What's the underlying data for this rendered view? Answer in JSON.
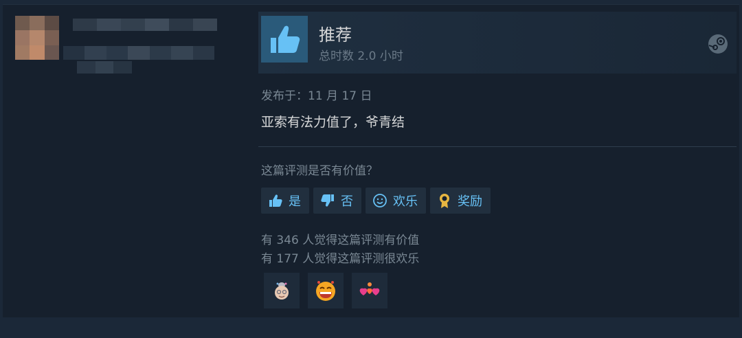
{
  "review": {
    "verdict": "推荐",
    "hours": "总时数 2.0 小时",
    "posted": "发布于：11 月 17 日",
    "text": "亚索有法力值了，爷青结"
  },
  "helpful": {
    "question": "这篇评测是否有价值？",
    "buttons": [
      {
        "label": "是",
        "icon": "thumbs-up-icon"
      },
      {
        "label": "否",
        "icon": "thumbs-down-icon"
      },
      {
        "label": "欢乐",
        "icon": "smiley-icon"
      },
      {
        "label": "奖励",
        "icon": "award-medal-icon"
      }
    ],
    "stats": [
      "有 346 人觉得这篇评测有价值",
      "有 177 人觉得这篇评测很欢乐"
    ]
  },
  "awards": [
    "grandma-award-icon",
    "laughing-face-award-icon",
    "hearts-award-icon"
  ],
  "colors": {
    "background": "#1b2838",
    "card": "#16202d",
    "accent": "#67c1f5",
    "award_gold": "#e7b641"
  }
}
